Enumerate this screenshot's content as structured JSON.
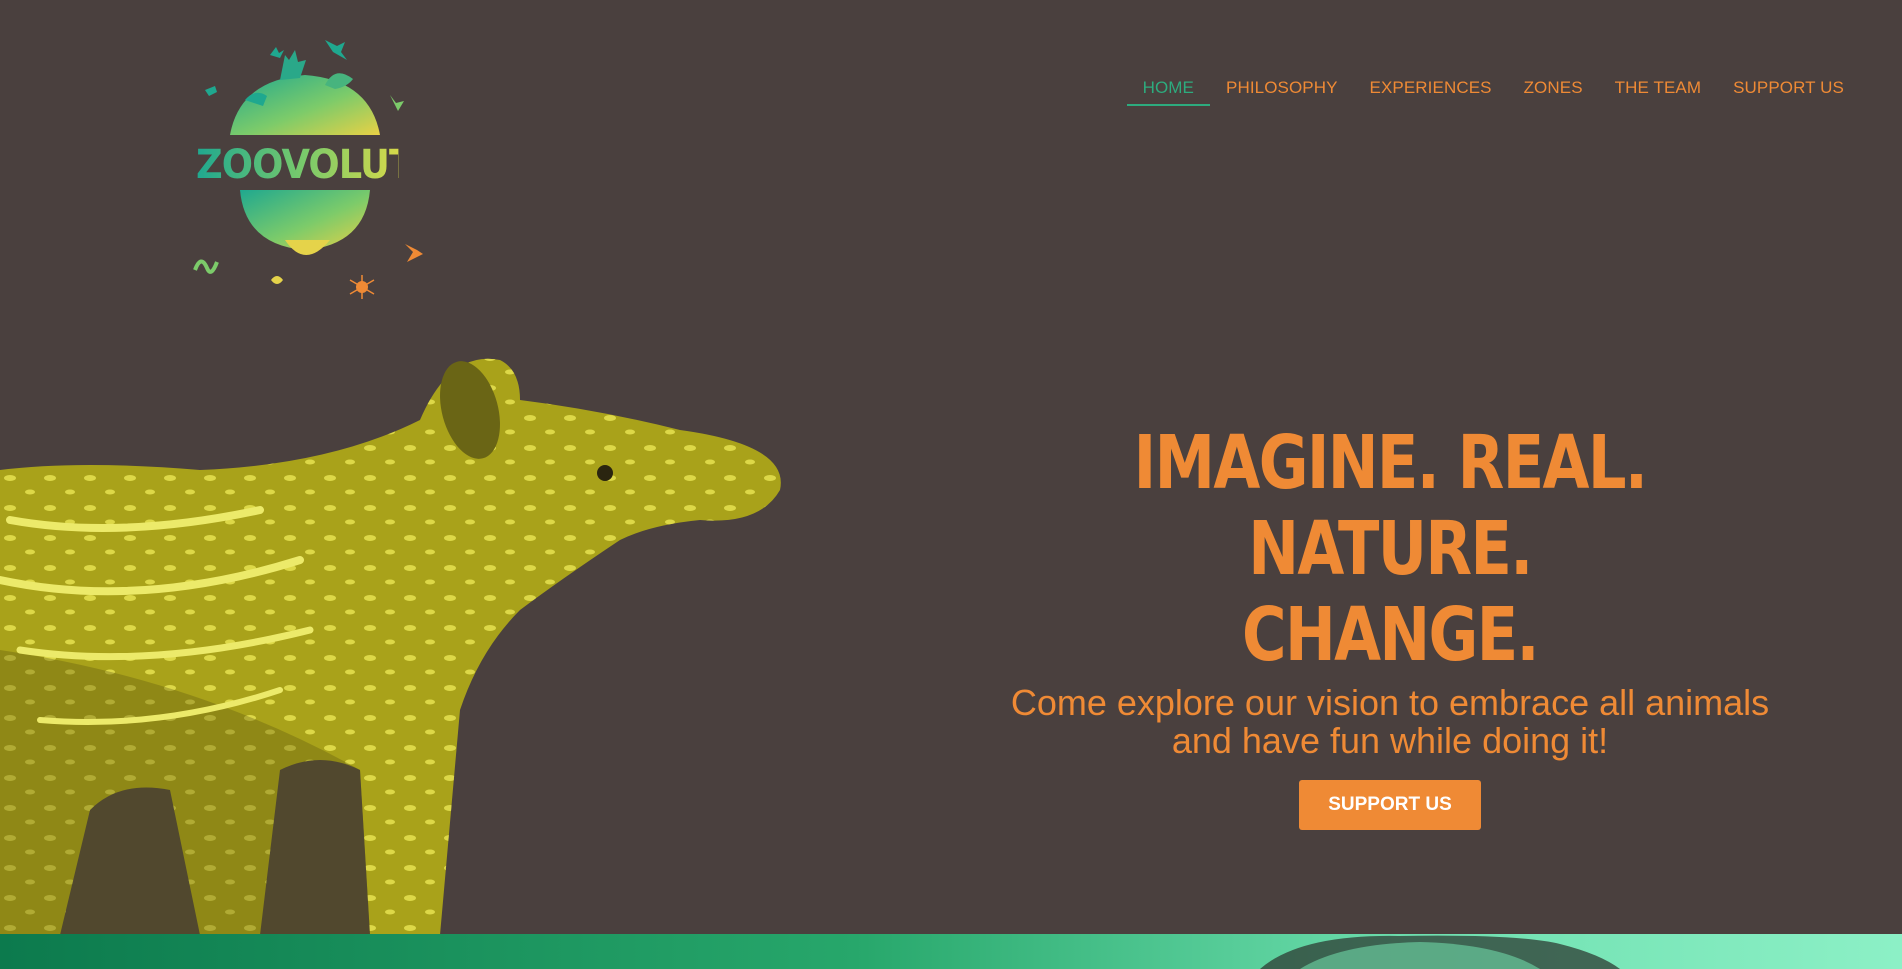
{
  "brand": {
    "name": "ZOOVOLUTION"
  },
  "nav": {
    "items": [
      {
        "label": "HOME",
        "active": true
      },
      {
        "label": "PHILOSOPHY"
      },
      {
        "label": "EXPERIENCES"
      },
      {
        "label": "ZONES"
      },
      {
        "label": "THE TEAM"
      },
      {
        "label": "SUPPORT US"
      }
    ]
  },
  "hero": {
    "headline_line1": "IMAGINE. REAL. NATURE.",
    "headline_line2": "CHANGE.",
    "subtitle": "Come explore our vision to embrace all animals and have fun while doing it!",
    "cta_label": "SUPPORT US"
  },
  "colors": {
    "background": "#4a403e",
    "accent_orange": "#ef8a35",
    "accent_green": "#2dab7e",
    "tapir_tint": "#a9a21a"
  },
  "icons": [
    "logo-globe-animals-icon",
    "tapir-image",
    "bird-image"
  ]
}
